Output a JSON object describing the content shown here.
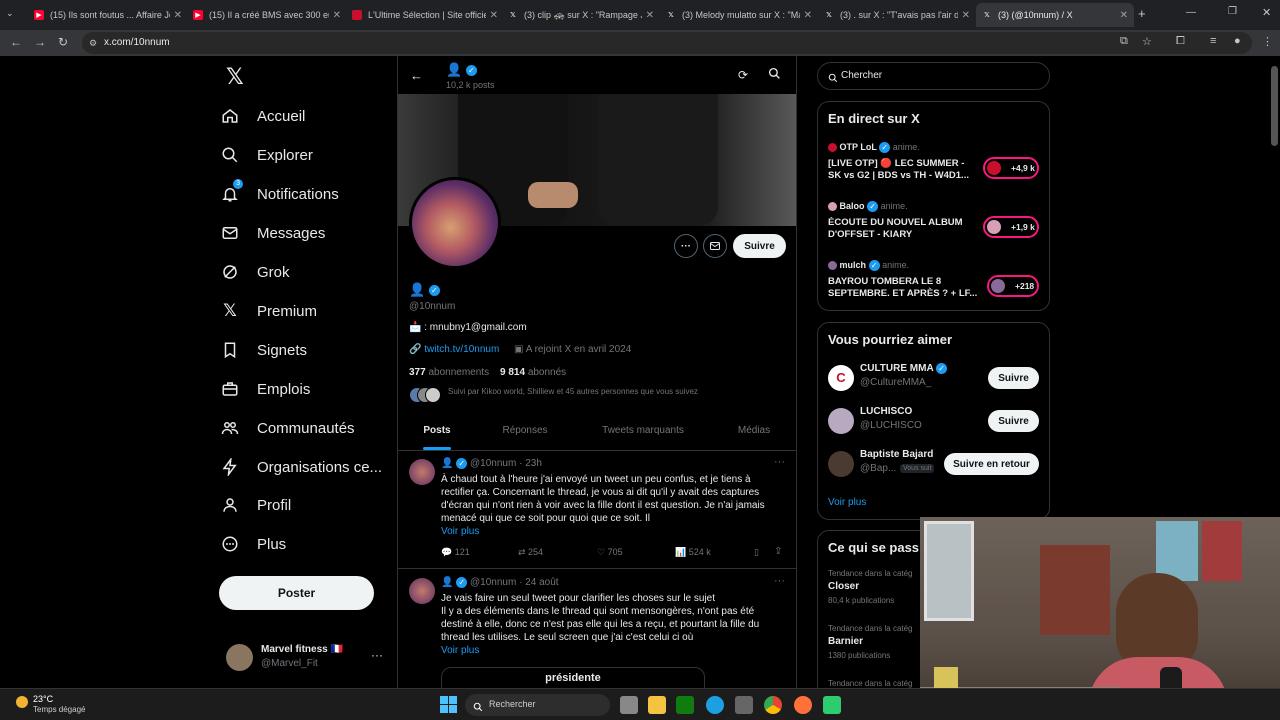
{
  "browser": {
    "tabs": [
      {
        "title": "(15) Ils sont foutus ... Affaire Je",
        "favicon_color": "#ff0033"
      },
      {
        "title": "(15) Il a créé BMS avec 300 eur",
        "favicon_color": "#ff0033"
      },
      {
        "title": "L'Ultime Sélection | Site officiel",
        "favicon_color": "#c8102e"
      },
      {
        "title": "(3) clip 🚓 sur X : \"Rampage Ja",
        "favicon_color": "#e7e9ea"
      },
      {
        "title": "(3) Melody mulatto sur X : \"Ma",
        "favicon_color": "#e7e9ea"
      },
      {
        "title": "(3) . sur X : \"T'avais pas l'air de",
        "favicon_color": "#e7e9ea"
      },
      {
        "title": "(3)      (@10nnum) / X",
        "favicon_color": "#e7e9ea"
      }
    ],
    "url": "x.com/10nnum"
  },
  "nav": {
    "items": [
      {
        "label": "Accueil",
        "icon": "home-icon"
      },
      {
        "label": "Explorer",
        "icon": "search-icon"
      },
      {
        "label": "Notifications",
        "icon": "bell-icon",
        "badge": "3"
      },
      {
        "label": "Messages",
        "icon": "mail-icon"
      },
      {
        "label": "Grok",
        "icon": "grok-icon"
      },
      {
        "label": "Premium",
        "icon": "x-logo-icon"
      },
      {
        "label": "Signets",
        "icon": "bookmark-icon"
      },
      {
        "label": "Emplois",
        "icon": "briefcase-icon"
      },
      {
        "label": "Communautés",
        "icon": "people-icon"
      },
      {
        "label": "Organisations ce...",
        "icon": "lightning-icon"
      },
      {
        "label": "Profil",
        "icon": "person-icon"
      },
      {
        "label": "Plus",
        "icon": "more-circle-icon"
      }
    ],
    "post_label": "Poster",
    "account": {
      "name": "Marvel fitness 🇫🇷",
      "handle": "@Marvel_Fit"
    }
  },
  "profile": {
    "header_posts": "10,2 k posts",
    "handle": "@10nnum",
    "bio": ": mnubny1@gmail.com",
    "link": "twitch.tv/10nnum",
    "joined": "A rejoint X en avril 2024",
    "following_count": "377",
    "following_label": "abonnements",
    "followers_count": "9 814",
    "followers_label": "abonnés",
    "followed_by": "Suivi par Kikoo world, Shilliew et 45 autres personnes que vous suivez",
    "follow_label": "Suivre",
    "tabs": [
      "Posts",
      "Réponses",
      "Tweets marquants",
      "Médias"
    ]
  },
  "tweets": [
    {
      "handle": "@10nnum",
      "time": "· 23h",
      "text": "À chaud tout à l'heure j'ai envoyé un tweet un peu confus, et je tiens à rectifier ça. Concernant le thread, je vous ai dit qu'il y avait des captures d'écran qui n'ont rien à voir avec la fille dont il est question. Je n'ai jamais menacé qui que ce soit pour quoi que ce soit. Il",
      "more": "Voir plus",
      "replies": "121",
      "retweets": "254",
      "likes": "705",
      "views": "524 k"
    },
    {
      "handle": "@10nnum",
      "time": "· 24 août",
      "text": "Je vais faire un seul tweet pour clarifier les choses sur le sujet\nIl y a des éléments dans le thread qui sont mensongères, n'ont pas été destiné à elle, donc ce n'est pas elle qui les a reçu, et pourtant la fille du thread les utilises. Le seul screen que j'ai c'est celui ci où",
      "more": "Voir plus",
      "embed_title": "présidente"
    }
  ],
  "search_placeholder": "Chercher",
  "live": {
    "title": "En direct sur X",
    "items": [
      {
        "host": "OTP LoL",
        "suffix": "anime.",
        "title": "[LIVE OTP] 🔴 LEC SUMMER - SK vs G2 | BDS vs TH - W4D1...",
        "count": "+4,9 k"
      },
      {
        "host": "Baloo",
        "suffix": "anime.",
        "title": "ÉCOUTE DU NOUVEL ALBUM D'OFFSET - KIARY",
        "count": "+1,9 k"
      },
      {
        "host": "mulch",
        "suffix": "anime.",
        "title": "BAYROU TOMBERA LE 8 SEPTEMBRE. ET APRÈS ? + LF...",
        "count": "+218"
      }
    ]
  },
  "suggest": {
    "title": "Vous pourriez aimer",
    "items": [
      {
        "name": "CULTURE MMA",
        "handle": "@CultureMMA_",
        "button": "Suivre"
      },
      {
        "name": "LUCHISCO",
        "handle": "@LUCHISCO",
        "button": "Suivre"
      },
      {
        "name": "Baptiste Bajard",
        "handle": "@Bap...",
        "tag": "Vous suit",
        "button": "Suivre en retour"
      }
    ],
    "more": "Voir plus"
  },
  "trends": {
    "title": "Ce qui se pass",
    "items": [
      {
        "category": "Tendance dans la catég",
        "name": "Closer",
        "count": "80,4 k publications"
      },
      {
        "category": "Tendance dans la catég",
        "name": "Barnier",
        "count": "1380 publications"
      },
      {
        "category": "Tendance dans la catég",
        "name": "",
        "count": ""
      }
    ]
  },
  "taskbar": {
    "weather_temp": "23°C",
    "weather_desc": "Temps dégagé",
    "search": "Rechercher"
  },
  "colors": {
    "accent": "#1d9bf0",
    "bg": "#000000",
    "border": "#2f3336",
    "muted": "#71767b",
    "live_red": "#f91880"
  }
}
